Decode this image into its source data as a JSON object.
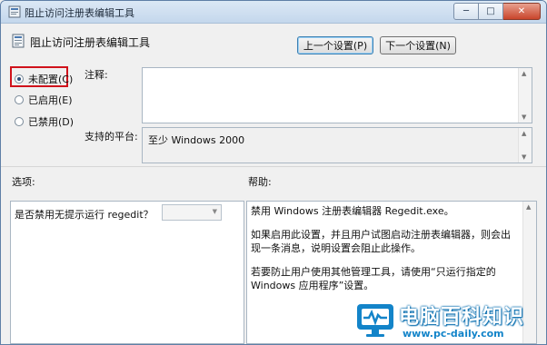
{
  "window": {
    "title": "阻止访问注册表编辑工具",
    "controls": {
      "minimize": "─",
      "maximize": "□",
      "close": "✕"
    }
  },
  "header": {
    "setting_name": "阻止访问注册表编辑工具",
    "prev_button": "上一个设置(P)",
    "next_button": "下一个设置(N)"
  },
  "state": {
    "options": [
      {
        "label": "未配置(C)",
        "checked": true
      },
      {
        "label": "已启用(E)",
        "checked": false
      },
      {
        "label": "已禁用(D)",
        "checked": false
      }
    ]
  },
  "comment": {
    "label": "注释:",
    "value": ""
  },
  "platform": {
    "label": "支持的平台:",
    "value": "至少 Windows 2000"
  },
  "sections": {
    "options_label": "选项:",
    "help_label": "帮助:"
  },
  "options_pane": {
    "question": "是否禁用无提示运行 regedit？",
    "dropdown_value": ""
  },
  "help": {
    "paragraphs": [
      "禁用 Windows 注册表编辑器 Regedit.exe。",
      "如果启用此设置，并且用户试图启动注册表编辑器，则会出现一条消息，说明设置会阻止此操作。",
      "若要防止用户使用其他管理工具，请使用“只运行指定的 Windows 应用程序”设置。"
    ]
  },
  "watermark": {
    "title": "电脑百科知识",
    "url": "www.pc-daily.com"
  },
  "colors": {
    "highlight": "#d0121b",
    "titlebar": "#c4d7ec",
    "watermark": "#1384c9"
  }
}
